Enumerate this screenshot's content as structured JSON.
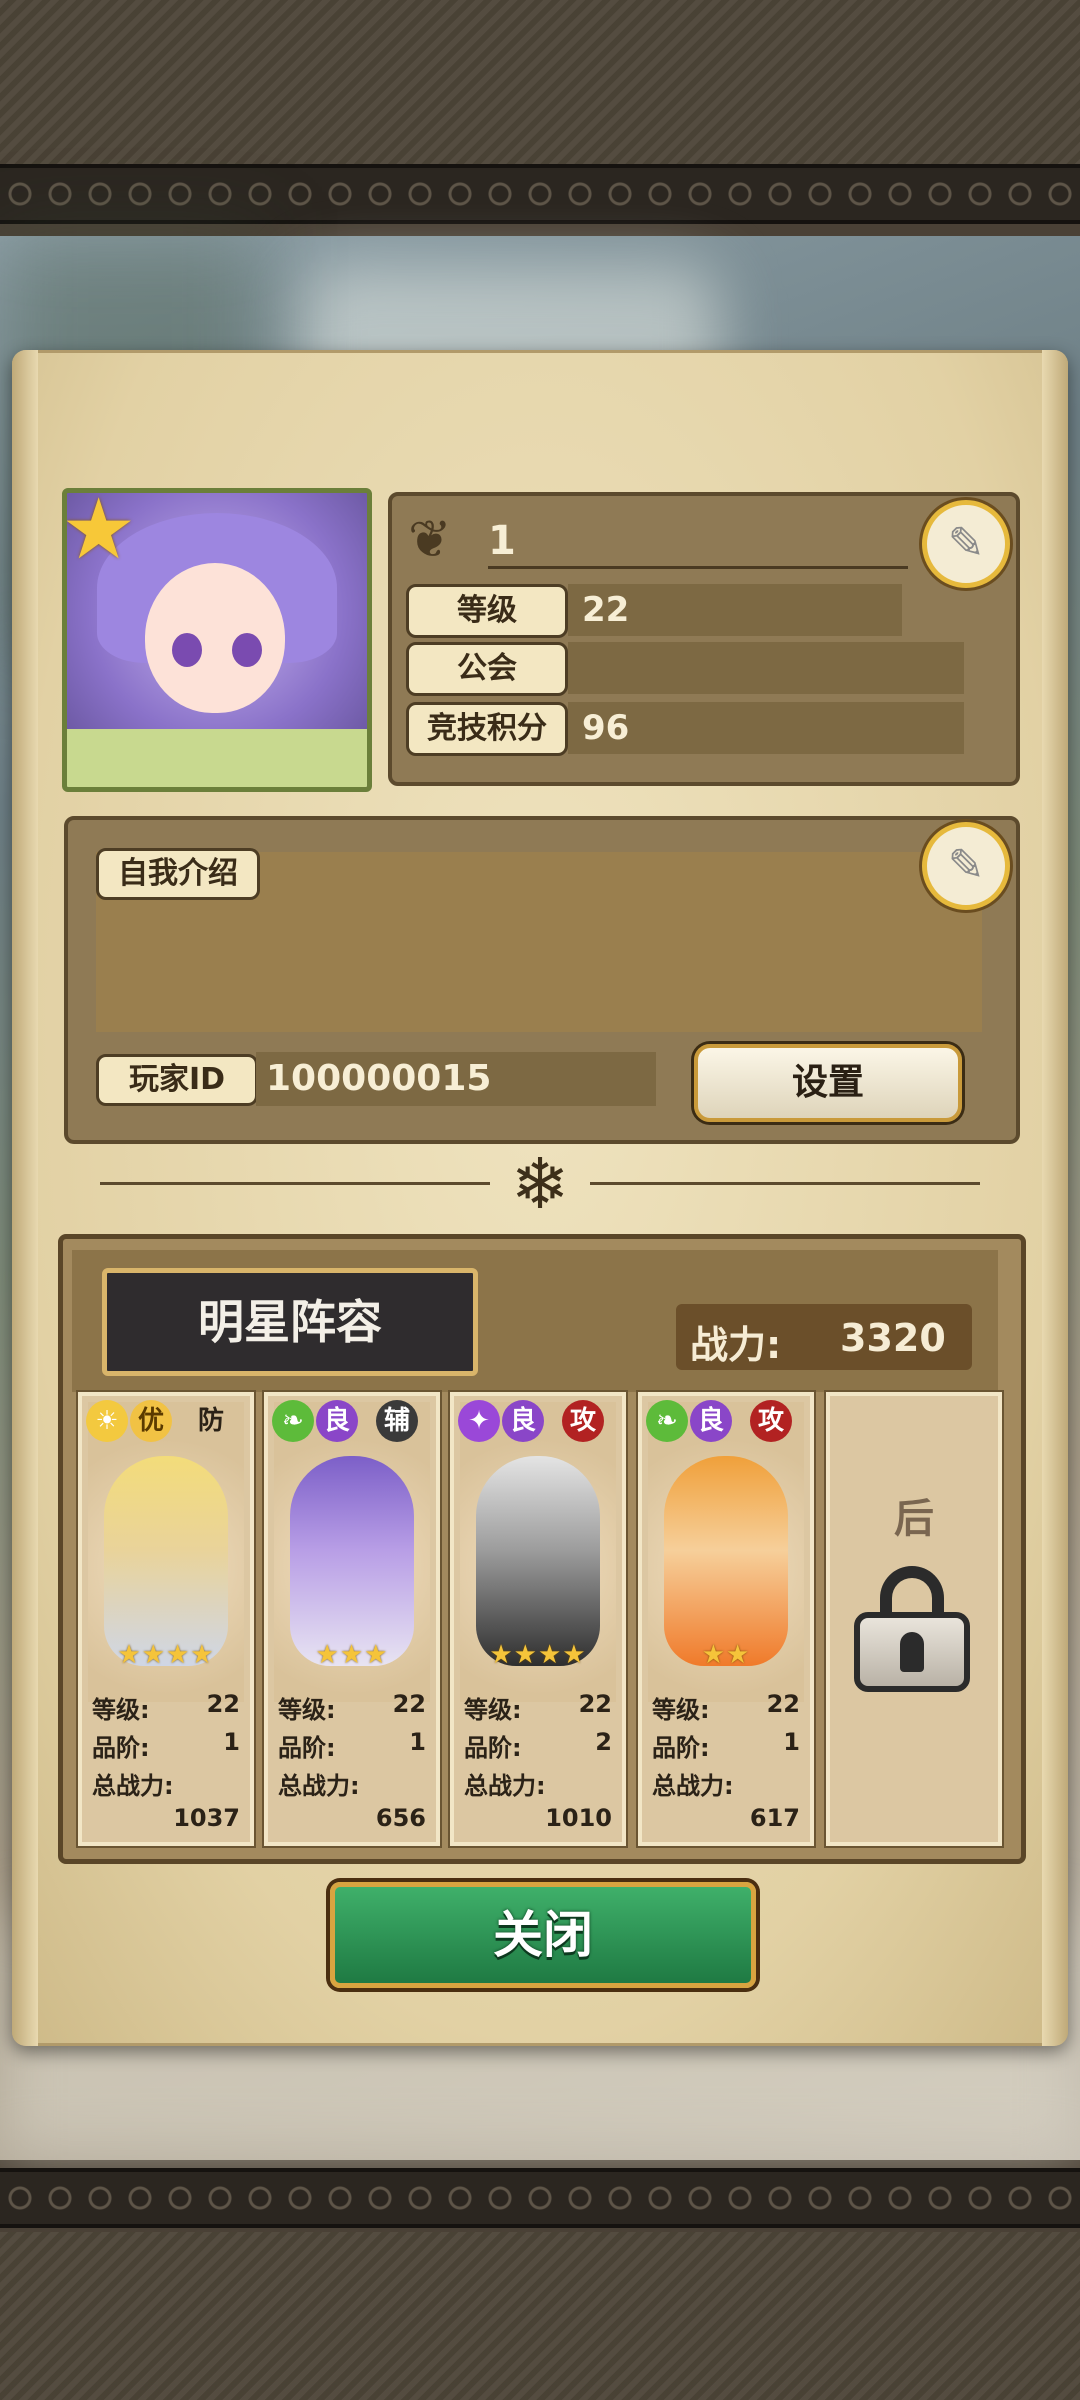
{
  "profile": {
    "name": "1",
    "level_label": "等级",
    "level_value": "22",
    "guild_label": "公会",
    "guild_value": "",
    "arena_label": "竞技积分",
    "arena_value": "96"
  },
  "intro": {
    "label": "自我介绍",
    "text": "",
    "player_id_label": "玩家ID",
    "player_id_value": "100000015",
    "settings_button": "设置"
  },
  "lineup": {
    "title": "明星阵容",
    "power_label": "战力:",
    "power_value": "3320",
    "stat_labels": {
      "level": "等级:",
      "rank": "品阶:",
      "total_power": "总战力:"
    },
    "heroes": [
      {
        "quality": "优",
        "role": "防",
        "element_color": "#f3c93f",
        "level": "22",
        "rank": "1",
        "power": "1037",
        "stars": 4
      },
      {
        "quality": "良",
        "role": "辅",
        "element_color": "#5dbb3a",
        "level": "22",
        "rank": "1",
        "power": "656",
        "stars": 3
      },
      {
        "quality": "良",
        "role": "攻",
        "element_color": "#9a48d8",
        "level": "22",
        "rank": "2",
        "power": "1010",
        "stars": 4
      },
      {
        "quality": "良",
        "role": "攻",
        "element_color": "#5dbb3a",
        "level": "22",
        "rank": "1",
        "power": "617",
        "stars": 2
      }
    ],
    "locked_slot": {
      "position": "后"
    }
  },
  "close_button": "关闭",
  "icons": {
    "avatar_star": "star-icon",
    "edit": "quill-edit-icon",
    "lock": "padlock-icon"
  },
  "colors": {
    "parchment": "#e8d9b0",
    "panel": "#8f7a55",
    "accent_gold": "#e6b93c",
    "close_green": "#2c9a57"
  }
}
